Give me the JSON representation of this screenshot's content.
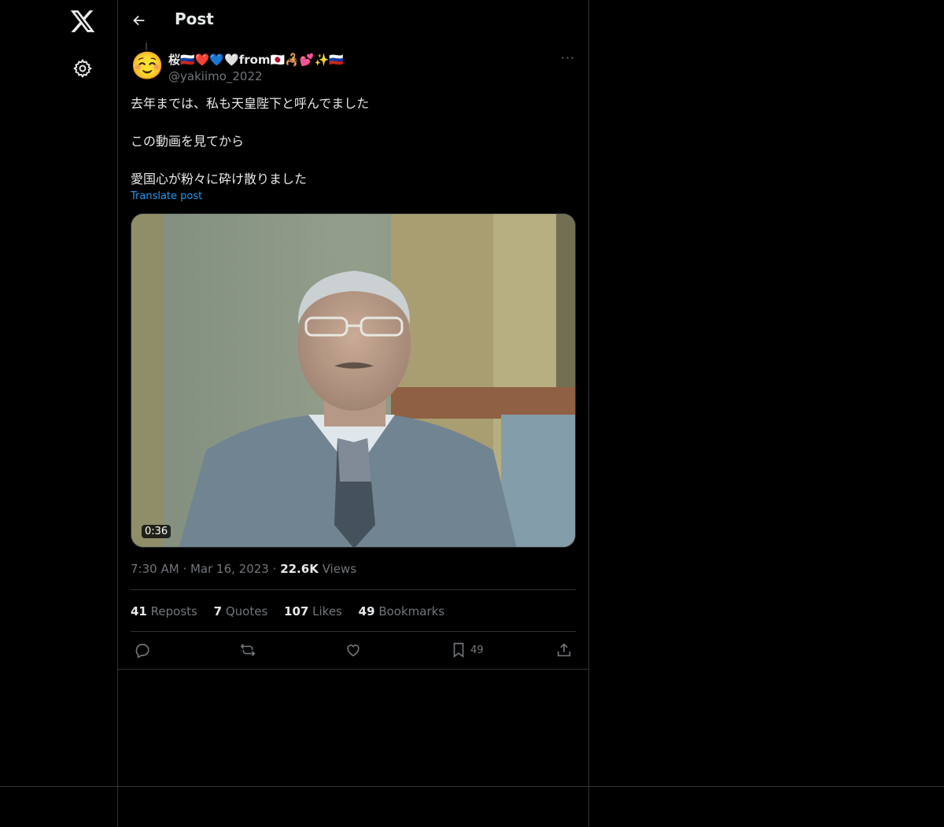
{
  "nav": {
    "logo": "x-logo",
    "settings_icon": "gear-icon"
  },
  "header": {
    "back_icon": "arrow-left-icon",
    "title": "Post"
  },
  "post": {
    "display_name": "桜🇷🇺❤️💙🤍from🇯🇵🦂💕✨🇷🇺",
    "handle": "@yakiimo_2022",
    "avatar_emoji": "☺️",
    "more_label": "···",
    "text": [
      "去年までは、私も天皇陛下と呼んでました",
      "この動画を見てから",
      "愛国心が粉々に砕け散りました"
    ],
    "translate_label": "Translate post",
    "video_duration": "0:36",
    "time": "7:30 AM",
    "date": "Mar 16, 2023",
    "views_count": "22.6K",
    "views_label": "Views",
    "stats": {
      "reposts_count": "41",
      "reposts_label": "Reposts",
      "quotes_count": "7",
      "quotes_label": "Quotes",
      "likes_count": "107",
      "likes_label": "Likes",
      "bookmarks_count": "49",
      "bookmarks_label": "Bookmarks"
    },
    "actions": {
      "reply_icon": "reply-icon",
      "repost_icon": "repost-icon",
      "like_icon": "heart-icon",
      "bookmark_icon": "bookmark-icon",
      "bookmark_count": "49",
      "share_icon": "share-icon"
    }
  },
  "colors": {
    "background": "#000000",
    "accent": "#1d9bf0",
    "muted": "#71767b",
    "border": "#2f3336"
  }
}
